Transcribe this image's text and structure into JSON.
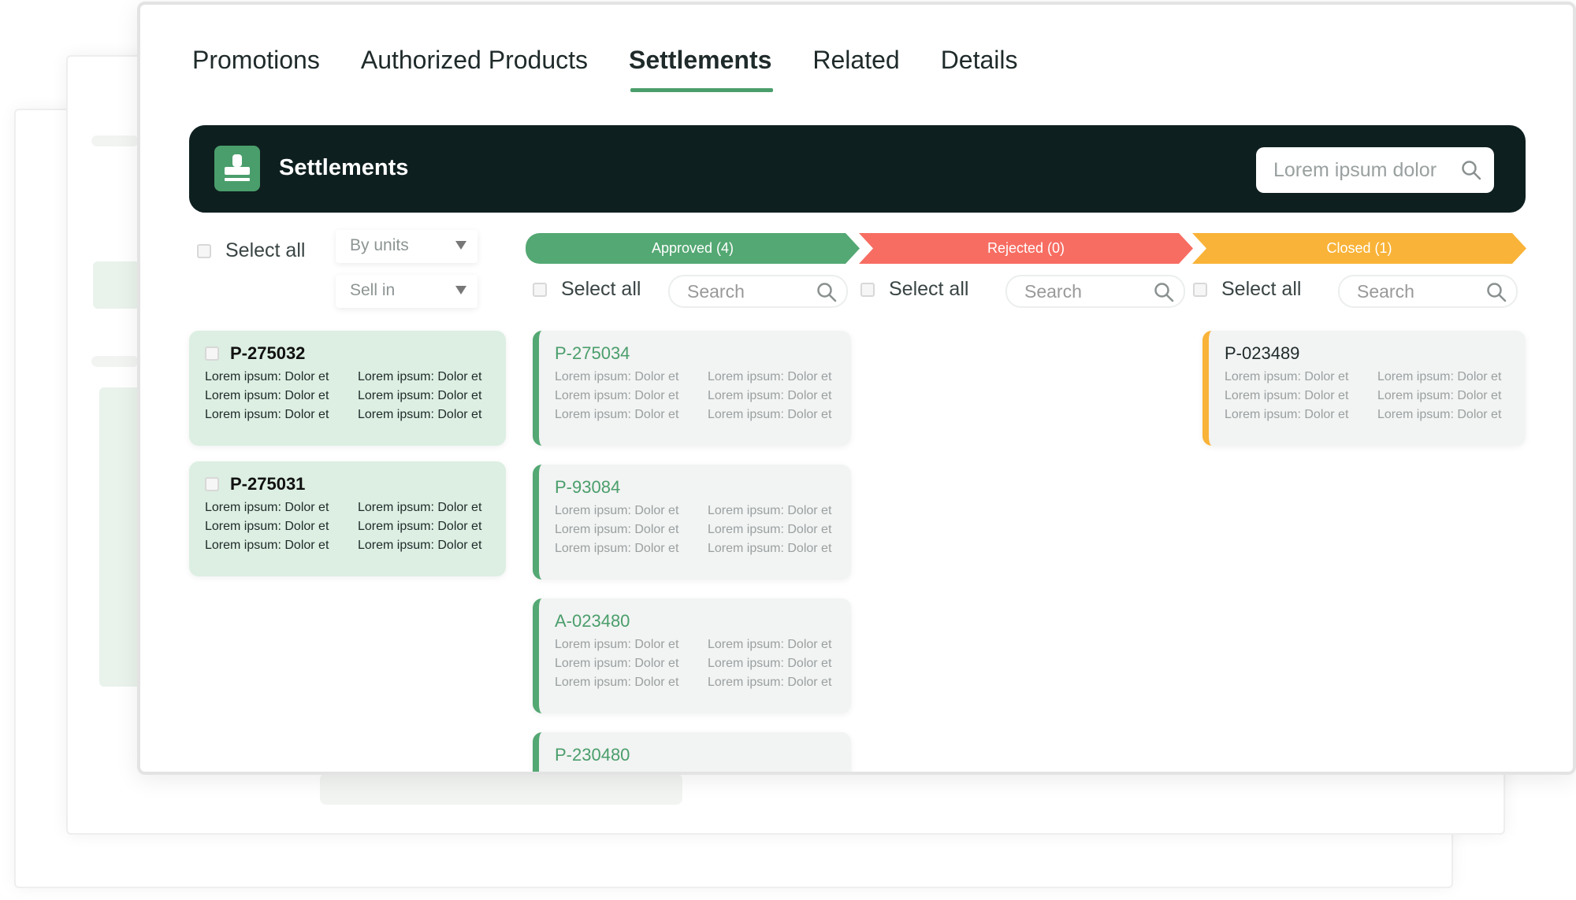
{
  "tabs": [
    "Promotions",
    "Authorized Products",
    "Settlements",
    "Related",
    "Details"
  ],
  "active_tab": "Settlements",
  "header": {
    "title": "Settlements",
    "search_placeholder": "Lorem ipsum dolor"
  },
  "left_panel": {
    "select_all": "Select all",
    "unit_select": "By units",
    "type_select": "Sell in",
    "cards": [
      {
        "id": "P-275032",
        "lines": [
          "Lorem ipsum: Dolor et",
          "Lorem ipsum: Dolor et",
          "Lorem ipsum: Dolor et",
          "Lorem ipsum: Dolor et",
          "Lorem ipsum: Dolor et",
          "Lorem ipsum: Dolor et"
        ]
      },
      {
        "id": "P-275031",
        "lines": [
          "Lorem ipsum: Dolor et",
          "Lorem ipsum: Dolor et",
          "Lorem ipsum: Dolor et",
          "Lorem ipsum: Dolor et",
          "Lorem ipsum: Dolor et",
          "Lorem ipsum: Dolor et"
        ]
      }
    ]
  },
  "columns": {
    "approved": {
      "label": "Approved (4)",
      "select_all": "Select all",
      "search_placeholder": "Search",
      "cards": [
        {
          "id": "P-275034",
          "lines": [
            "Lorem ipsum: Dolor et",
            "Lorem ipsum: Dolor et",
            "Lorem ipsum: Dolor et",
            "Lorem ipsum: Dolor et",
            "Lorem ipsum: Dolor et",
            "Lorem ipsum: Dolor et"
          ]
        },
        {
          "id": "P-93084",
          "lines": [
            "Lorem ipsum: Dolor et",
            "Lorem ipsum: Dolor et",
            "Lorem ipsum: Dolor et",
            "Lorem ipsum: Dolor et",
            "Lorem ipsum: Dolor et",
            "Lorem ipsum: Dolor et"
          ]
        },
        {
          "id": "A-023480",
          "lines": [
            "Lorem ipsum: Dolor et",
            "Lorem ipsum: Dolor et",
            "Lorem ipsum: Dolor et",
            "Lorem ipsum: Dolor et",
            "Lorem ipsum: Dolor et",
            "Lorem ipsum: Dolor et"
          ]
        },
        {
          "id": "P-230480",
          "lines": []
        }
      ]
    },
    "rejected": {
      "label": "Rejected (0)",
      "select_all": "Select all",
      "search_placeholder": "Search",
      "cards": []
    },
    "closed": {
      "label": "Closed (1)",
      "select_all": "Select all",
      "search_placeholder": "Search",
      "cards": [
        {
          "id": "P-023489",
          "lines": [
            "Lorem ipsum: Dolor et",
            "Lorem ipsum: Dolor et",
            "Lorem ipsum: Dolor et",
            "Lorem ipsum: Dolor et",
            "Lorem ipsum: Dolor et",
            "Lorem ipsum: Dolor et"
          ]
        }
      ]
    }
  },
  "colors": {
    "accent": "#4a9e6b",
    "approved": "#54a873",
    "rejected": "#f76d62",
    "closed": "#f9b338",
    "header_bg": "#0e1f1f"
  }
}
